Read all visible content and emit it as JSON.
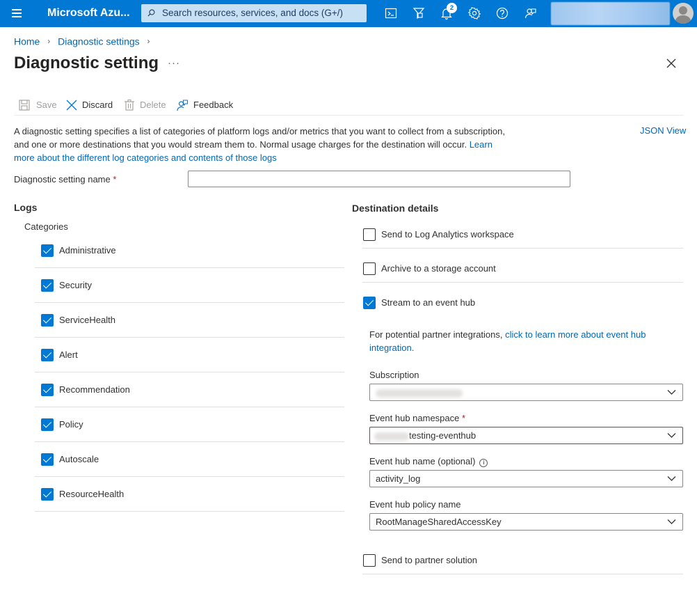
{
  "topbar": {
    "brand": "Microsoft Azu...",
    "search_placeholder": "Search resources, services, and docs (G+/)",
    "notification_count": "2",
    "icons": [
      "cloud-shell-icon",
      "directory-filter-icon",
      "notifications-icon",
      "settings-icon",
      "help-icon",
      "feedback-icon"
    ]
  },
  "breadcrumb": {
    "home": "Home",
    "diagnostic_settings": "Diagnostic settings"
  },
  "page": {
    "title": "Diagnostic setting",
    "more": "···"
  },
  "toolbar": {
    "save": "Save",
    "discard": "Discard",
    "delete": "Delete",
    "feedback": "Feedback"
  },
  "description": {
    "text": "A diagnostic setting specifies a list of categories of platform logs and/or metrics that you want to collect from a subscription, and one or more destinations that you would stream them to. Normal usage charges for the destination will occur. ",
    "link": "Learn more about the different log categories and contents of those logs",
    "json_view": "JSON View"
  },
  "setting_name": {
    "label": "Diagnostic setting name",
    "required_mark": "*",
    "value": ""
  },
  "logs": {
    "title": "Logs",
    "categories_label": "Categories",
    "categories": [
      {
        "label": "Administrative",
        "checked": true
      },
      {
        "label": "Security",
        "checked": true
      },
      {
        "label": "ServiceHealth",
        "checked": true
      },
      {
        "label": "Alert",
        "checked": true
      },
      {
        "label": "Recommendation",
        "checked": true
      },
      {
        "label": "Policy",
        "checked": true
      },
      {
        "label": "Autoscale",
        "checked": true
      },
      {
        "label": "ResourceHealth",
        "checked": true
      }
    ]
  },
  "destination": {
    "title": "Destination details",
    "log_analytics": {
      "label": "Send to Log Analytics workspace",
      "checked": false
    },
    "storage": {
      "label": "Archive to a storage account",
      "checked": false
    },
    "event_hub": {
      "label": "Stream to an event hub",
      "checked": true
    },
    "partner_note": "For potential partner integrations, ",
    "partner_link": "click to learn more about event hub integration.",
    "subscription": {
      "label": "Subscription",
      "value": ""
    },
    "namespace": {
      "label": "Event hub namespace",
      "required_mark": "*",
      "value": "testing-eventhub"
    },
    "hub_name": {
      "label": "Event hub name (optional)",
      "value": "activity_log"
    },
    "policy": {
      "label": "Event hub policy name",
      "value": "RootManageSharedAccessKey"
    },
    "partner_solution": {
      "label": "Send to partner solution",
      "checked": false
    }
  },
  "colors": {
    "accent": "#0078d4",
    "link": "#0067b8",
    "required": "#a4262c",
    "focus_border": "#8a2b9c"
  }
}
